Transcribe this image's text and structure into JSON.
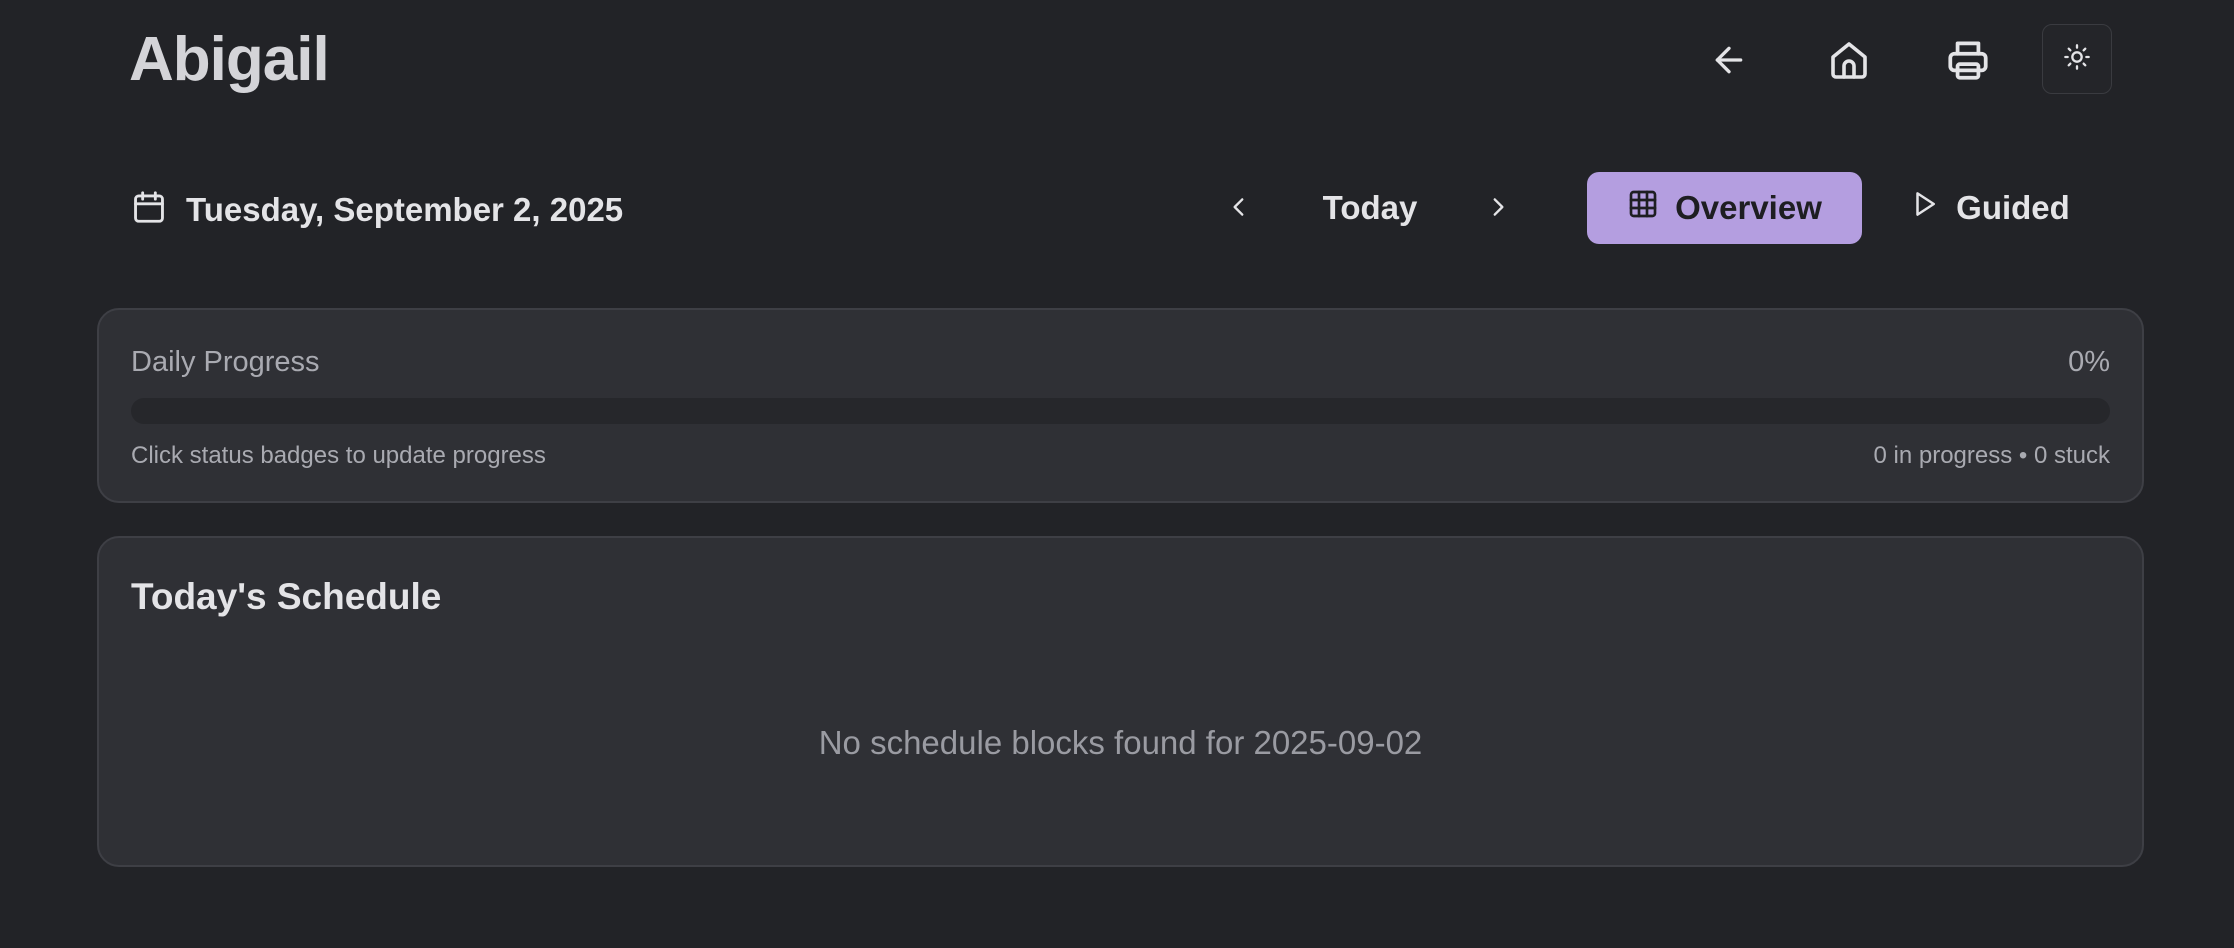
{
  "header": {
    "title": "Abigail",
    "buttons": [
      {
        "name": "back",
        "icon": "arrow-left-icon"
      },
      {
        "name": "home",
        "icon": "home-icon"
      },
      {
        "name": "print",
        "icon": "printer-icon"
      },
      {
        "name": "theme",
        "icon": "sun-icon"
      }
    ]
  },
  "nav": {
    "date_label": "Tuesday, September 2, 2025",
    "calendar_icon": "calendar-icon",
    "prev_icon": "chevron-left-icon",
    "today_label": "Today",
    "next_icon": "chevron-right-icon",
    "overview_label": "Overview",
    "overview_icon": "grid-icon",
    "guided_label": "Guided",
    "guided_icon": "play-icon"
  },
  "progress": {
    "label": "Daily Progress",
    "percent_text": "0%",
    "percent_value": 0,
    "hint": "Click status badges to update progress",
    "stats": "0 in progress • 0 stuck"
  },
  "schedule": {
    "title": "Today's Schedule",
    "empty_message": "No schedule blocks found for 2025-09-02"
  },
  "colors": {
    "background": "#222327",
    "card": "#2f3035",
    "accent": "#b49ee0"
  }
}
